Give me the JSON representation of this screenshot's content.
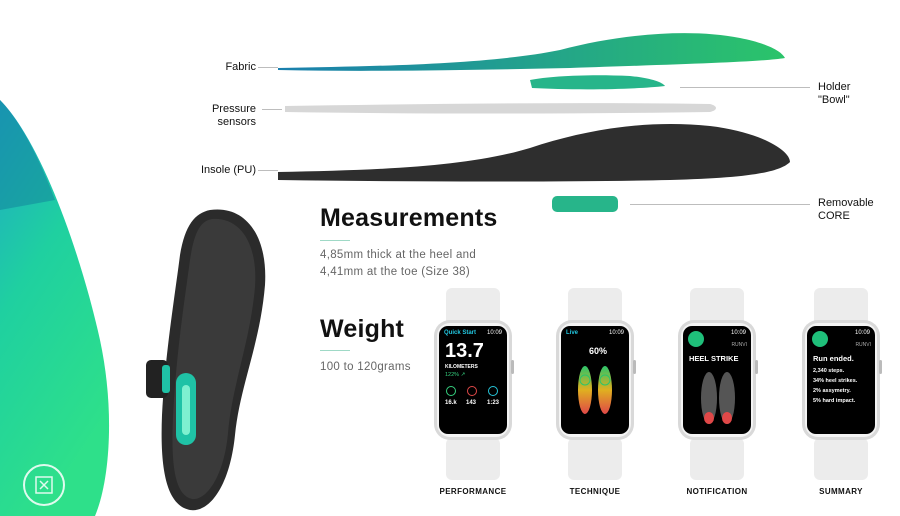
{
  "layers": {
    "fabric": "Fabric",
    "pressure_sensors": "Pressure\nsensors",
    "insole": "Insole (PU)",
    "holder": "Holder\n\"Bowl\"",
    "core": "Removable\nCORE"
  },
  "measurements": {
    "title": "Measurements",
    "line1": "4,85mm thick at the heel and",
    "line2": "4,41mm at the toe (Size 38)"
  },
  "weight": {
    "title": "Weight",
    "text": "100 to 120grams"
  },
  "watches": [
    {
      "caption": "PERFORMANCE",
      "header": "Quick Start",
      "time": "10:09",
      "big": "13.7",
      "unit": "KILOMETERS",
      "sub": "122% ↗",
      "stats": [
        "16.k",
        "143",
        "1:23"
      ]
    },
    {
      "caption": "TECHNIQUE",
      "header": "Live",
      "time": "10:09",
      "big": "60%"
    },
    {
      "caption": "NOTIFICATION",
      "time": "10:09",
      "brand": "RUNVI",
      "title": "HEEL STRIKE"
    },
    {
      "caption": "SUMMARY",
      "time": "10:09",
      "brand": "RUNVI",
      "title": "Run ended.",
      "lines": [
        "2,340 steps.",
        "34% heel strikes.",
        "2% assymetry.",
        "5% hard impact."
      ]
    }
  ],
  "colors": {
    "accent": "#1fbf7a",
    "teal": "#17a7b8",
    "dark": "#2a2a2a"
  }
}
